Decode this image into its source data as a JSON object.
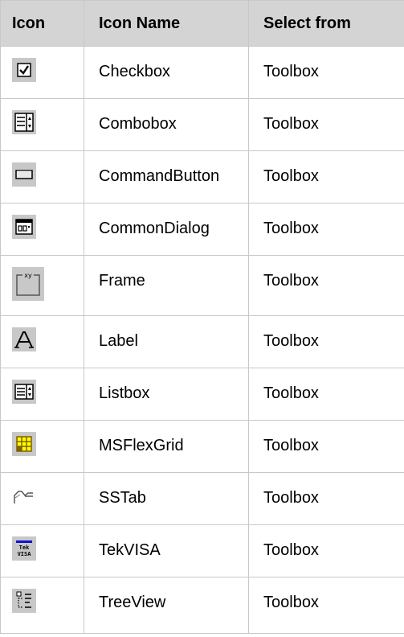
{
  "table": {
    "headers": {
      "icon": "Icon",
      "name": "Icon Name",
      "source": "Select from"
    },
    "rows": [
      {
        "icon": "checkbox-icon",
        "name": "Checkbox",
        "source": "Toolbox"
      },
      {
        "icon": "combobox-icon",
        "name": "Combobox",
        "source": "Toolbox"
      },
      {
        "icon": "command-button-icon",
        "name": "CommandButton",
        "source": "Toolbox"
      },
      {
        "icon": "common-dialog-icon",
        "name": "CommonDialog",
        "source": "Toolbox"
      },
      {
        "icon": "frame-icon",
        "name": "Frame",
        "source": "Toolbox"
      },
      {
        "icon": "label-icon",
        "name": "Label",
        "source": "Toolbox"
      },
      {
        "icon": "listbox-icon",
        "name": "Listbox",
        "source": "Toolbox"
      },
      {
        "icon": "msflexgrid-icon",
        "name": "MSFlexGrid",
        "source": "Toolbox"
      },
      {
        "icon": "sstab-icon",
        "name": "SSTab",
        "source": "Toolbox"
      },
      {
        "icon": "tekvisa-icon",
        "name": "TekVISA",
        "source": "Toolbox"
      },
      {
        "icon": "treeview-icon",
        "name": "TreeView",
        "source": "Toolbox"
      }
    ],
    "frame_icon_text": "xy",
    "tekvisa_icon_text": [
      "Tek",
      "VISA"
    ]
  }
}
